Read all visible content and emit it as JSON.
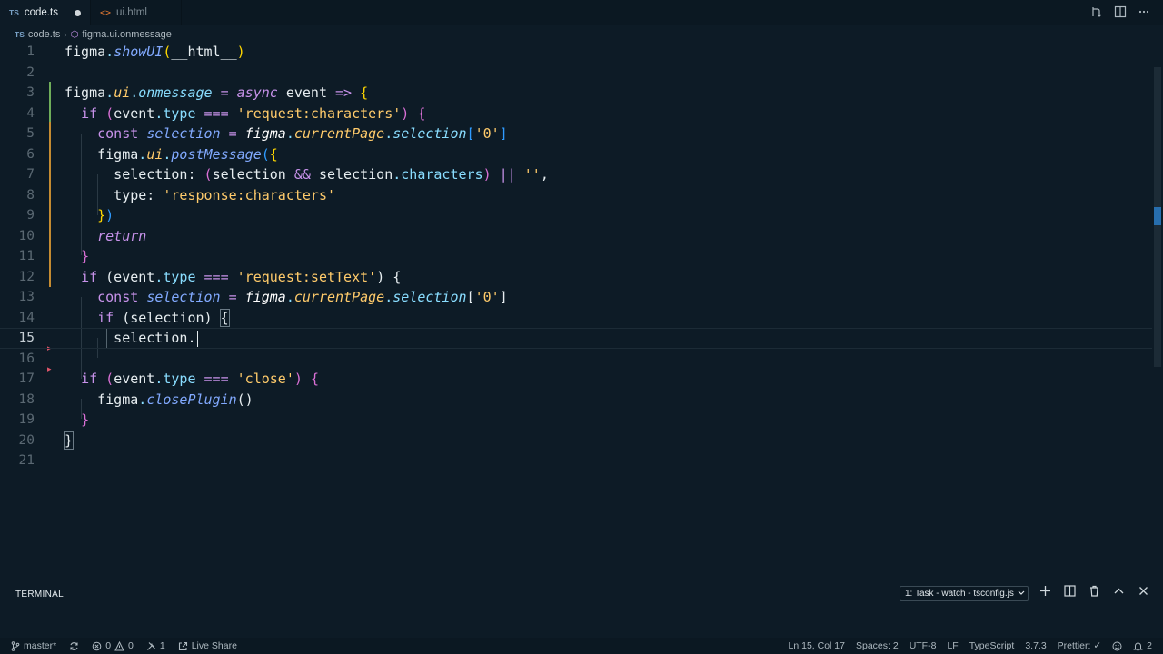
{
  "tabs": [
    {
      "badge": "TS",
      "label": "code.ts",
      "dirty": true
    },
    {
      "badge": "<>",
      "label": "ui.html",
      "dirty": false
    }
  ],
  "breadcrumb": {
    "file": "code.ts",
    "file_badge": "TS",
    "symbol": "figma.ui.onmessage"
  },
  "editor": {
    "current_line": 15,
    "line_numbers": [
      "1",
      "2",
      "3",
      "4",
      "5",
      "6",
      "7",
      "8",
      "9",
      "10",
      "11",
      "12",
      "13",
      "14",
      "15",
      "16",
      "17",
      "18",
      "19",
      "20",
      "21"
    ]
  },
  "panel": {
    "title": "TERMINAL",
    "task_select": "1: Task - watch - tsconfig.js"
  },
  "status": {
    "branch": "master*",
    "errors": "0",
    "warnings": "0",
    "ports": "1",
    "live_share": "Live Share",
    "position": "Ln 15, Col 17",
    "spaces": "Spaces: 2",
    "encoding": "UTF-8",
    "eol": "LF",
    "language": "TypeScript",
    "ts_version": "3.7.3",
    "prettier": "Prettier: ✓",
    "notifications": "2"
  },
  "colors": {
    "background": "#0d1b26",
    "keyword": "#c792ea",
    "string": "#ffcb6b",
    "function": "#82aaff"
  }
}
